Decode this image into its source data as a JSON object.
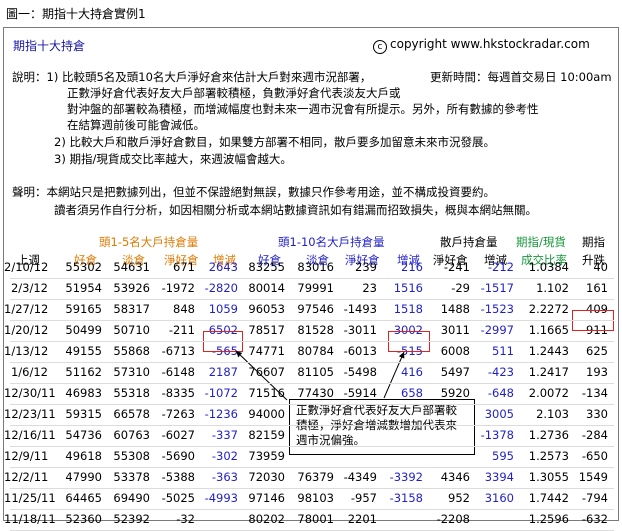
{
  "figure_title": "圖一：期指十大持倉實例1",
  "panel_title": "期指十大持倉",
  "copyright_text": "copyright www.hkstockradar.com",
  "copyright_symbol": "c",
  "update_time": "更新時間：每週首交易日 10:00am",
  "notes_lines": [
    "說明：1) 比較頭5名及頭10名大戶淨好倉來估計大戶對來週市況部署，",
    "正數淨好倉代表好友大戶部署較積極，負數淨好倉代表淡友大戶或",
    "對沖盤的部署較為積極，而增減幅度也對未來一週市況會有所提示。另外，所有數據的參考性",
    "在結算週前後可能會減低。",
    "2) 比較大戶和散戶淨好倉數目，如果雙方部署不相同，散戶要多加留意未來市況發展。",
    "3) 期指/現貨成交比率越大，來週波幅會越大。"
  ],
  "disclaimer_lines": [
    "聲明：本網站只是把數據列出，但並不保證絕對無誤，數據只作參考用途，並不構成投資要約。",
    "讀者須另作自行分析，如因相關分析或本網站數據資訊如有錯漏而招致損失，概與本網站無關。"
  ],
  "group_headers": {
    "top5": "頭1-5名大戶持倉量",
    "top10": "頭1-10名大戶持倉量",
    "retail": "散戶持倉量",
    "ratio_top": "期指/現貨",
    "ratio_bottom": "成交比率",
    "index_top": "期指",
    "index_bottom": "升跌"
  },
  "column_headers": [
    "上週",
    "好倉",
    "淡倉",
    "淨好倉",
    "增減",
    "好倉",
    "淡倉",
    "淨好倉",
    "增減",
    "淨好倉",
    "增減"
  ],
  "colors": {
    "orange": "#e07800",
    "blue": "#1f1fc8",
    "green": "#18963c",
    "highlight_box": "#d22222"
  },
  "rows": [
    [
      "2/10/12",
      "55302",
      "54631",
      "671",
      "2643",
      "83255",
      "83016",
      "239",
      "216",
      "-241",
      "-212",
      "1.0384",
      "40"
    ],
    [
      "2/3/12",
      "51954",
      "53926",
      "-1972",
      "-2820",
      "80014",
      "79991",
      "23",
      "1516",
      "-29",
      "-1517",
      "1.102",
      "161"
    ],
    [
      "1/27/12",
      "59165",
      "58317",
      "848",
      "1059",
      "96053",
      "97546",
      "-1493",
      "1518",
      "1488",
      "-1523",
      "2.2272",
      "409"
    ],
    [
      "1/20/12",
      "50499",
      "50710",
      "-211",
      "6502",
      "78517",
      "81528",
      "-3011",
      "3002",
      "3011",
      "-2997",
      "1.1665",
      "911"
    ],
    [
      "1/13/12",
      "49155",
      "55868",
      "-6713",
      "-565",
      "74771",
      "80784",
      "-6013",
      "-515",
      "6008",
      "511",
      "1.2443",
      "625"
    ],
    [
      "1/6/12",
      "51162",
      "57310",
      "-6148",
      "2187",
      "76607",
      "81105",
      "-5498",
      "416",
      "5497",
      "-423",
      "1.2417",
      "193"
    ],
    [
      "12/30/11",
      "46983",
      "55318",
      "-8335",
      "-1072",
      "71516",
      "77430",
      "-5914",
      "658",
      "5920",
      "-648",
      "2.0072",
      "-134"
    ],
    [
      "12/23/11",
      "59315",
      "66578",
      "-7263",
      "-1236",
      "94000",
      "",
      "",
      "",
      "",
      "3005",
      "2.103",
      "330"
    ],
    [
      "12/16/11",
      "54736",
      "60763",
      "-6027",
      "-337",
      "82159",
      "",
      "",
      "",
      "",
      "-1378",
      "1.2736",
      "-284"
    ],
    [
      "12/9/11",
      "49618",
      "55308",
      "-5690",
      "-302",
      "73959",
      "",
      "",
      "",
      "",
      "595",
      "1.2573",
      "-650"
    ],
    [
      "12/2/11",
      "47990",
      "53378",
      "-5388",
      "-363",
      "72030",
      "76379",
      "-4349",
      "-3392",
      "4346",
      "3394",
      "1.3055",
      "1549"
    ],
    [
      "11/25/11",
      "64465",
      "69490",
      "-5025",
      "-4993",
      "97146",
      "98103",
      "-957",
      "-3158",
      "952",
      "3160",
      "1.7442",
      "-794"
    ],
    [
      "11/18/11",
      "52360",
      "52392",
      "-32",
      "",
      "80202",
      "78001",
      "2201",
      "",
      "-2208",
      "",
      "1.2596",
      "-632"
    ]
  ],
  "callout_text": [
    "正數淨好倉代表好友大戶部署較",
    "積極，淨好倉增減數增加代表來",
    "週市況偏強。"
  ]
}
